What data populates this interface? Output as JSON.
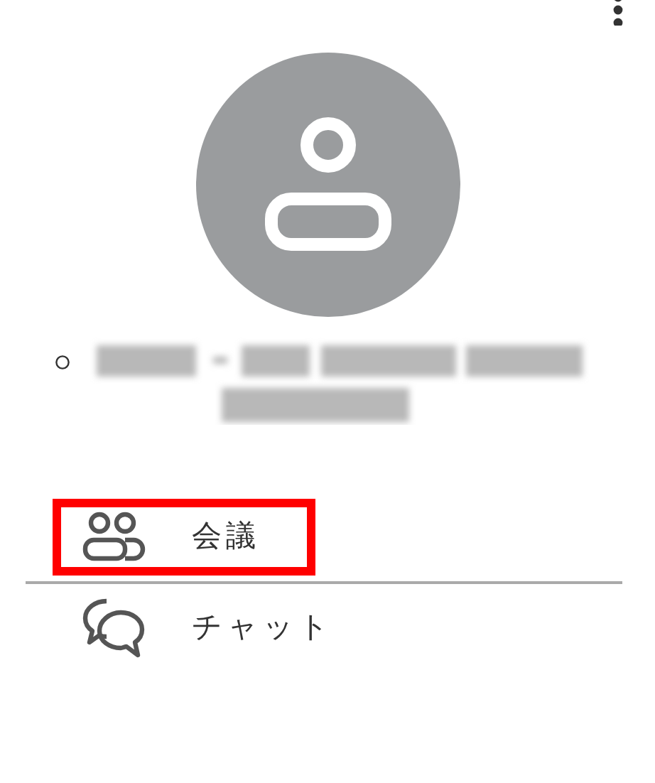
{
  "profile": {
    "online": false
  },
  "menu": [
    {
      "kind": "meetings",
      "label": "会議",
      "highlighted": true
    },
    {
      "kind": "chat",
      "label": "チャット",
      "highlighted": false
    }
  ]
}
